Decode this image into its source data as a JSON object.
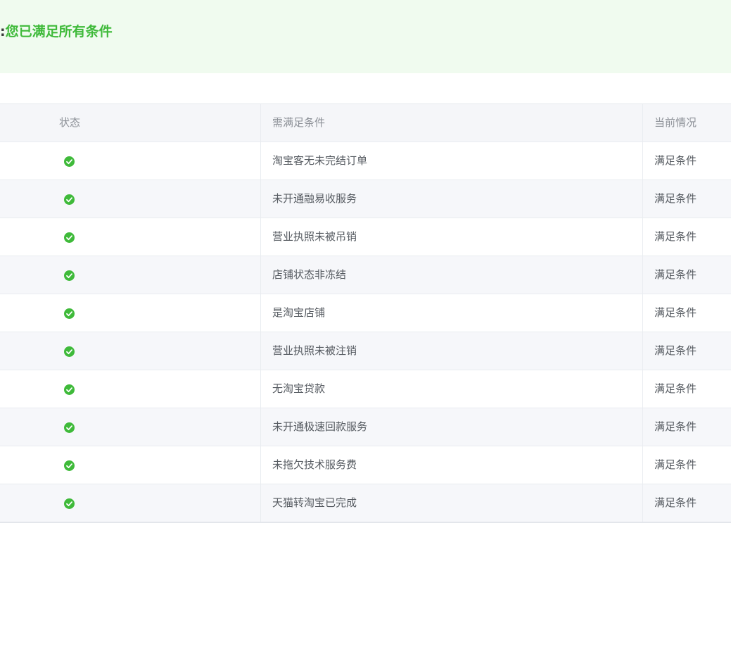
{
  "banner": {
    "colon": ":",
    "message": "您已满足所有条件",
    "color": "#3fba3a"
  },
  "table": {
    "headers": {
      "status": "状态",
      "condition": "需满足条件",
      "current": "当前情况"
    },
    "rows": [
      {
        "status_icon": "check-circle-icon",
        "condition": "淘宝客无未完结订单",
        "current": "满足条件"
      },
      {
        "status_icon": "check-circle-icon",
        "condition": "未开通融易收服务",
        "current": "满足条件"
      },
      {
        "status_icon": "check-circle-icon",
        "condition": "营业执照未被吊销",
        "current": "满足条件"
      },
      {
        "status_icon": "check-circle-icon",
        "condition": "店铺状态非冻结",
        "current": "满足条件"
      },
      {
        "status_icon": "check-circle-icon",
        "condition": "是淘宝店铺",
        "current": "满足条件"
      },
      {
        "status_icon": "check-circle-icon",
        "condition": "营业执照未被注销",
        "current": "满足条件"
      },
      {
        "status_icon": "check-circle-icon",
        "condition": "无淘宝贷款",
        "current": "满足条件"
      },
      {
        "status_icon": "check-circle-icon",
        "condition": "未开通极速回款服务",
        "current": "满足条件"
      },
      {
        "status_icon": "check-circle-icon",
        "condition": "未拖欠技术服务费",
        "current": "满足条件"
      },
      {
        "status_icon": "check-circle-icon",
        "condition": "天猫转淘宝已完成",
        "current": "满足条件"
      }
    ]
  }
}
